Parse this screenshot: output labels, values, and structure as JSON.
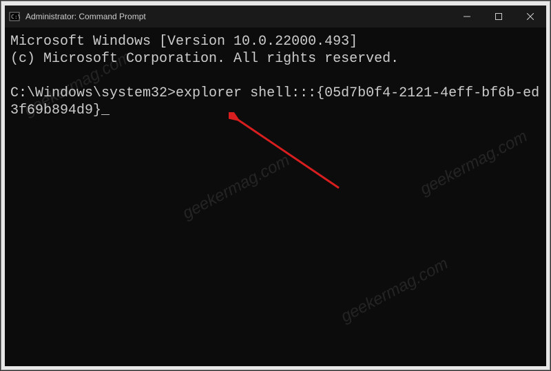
{
  "window": {
    "title": "Administrator: Command Prompt"
  },
  "terminal": {
    "line1": "Microsoft Windows [Version 10.0.22000.493]",
    "line2": "(c) Microsoft Corporation. All rights reserved.",
    "blank": "",
    "prompt_path": "C:\\Windows\\system32>",
    "command": "explorer shell:::{05d7b0f4-2121-4eff-bf6b-ed3f69b894d9}",
    "cursor": "_"
  },
  "watermark": {
    "text": "geekermag.com"
  }
}
